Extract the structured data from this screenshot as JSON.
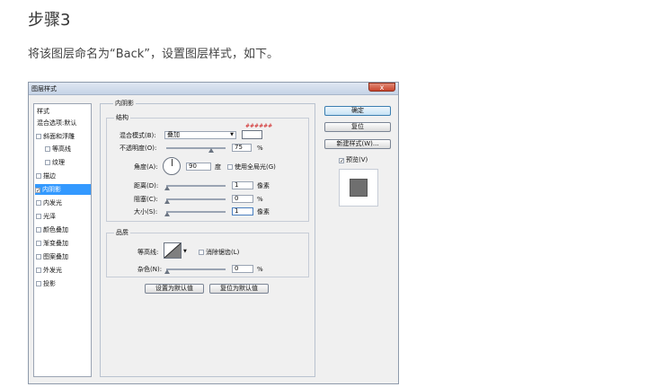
{
  "page": {
    "step_title": "步骤3",
    "instruction": "将该图层命名为“Back”，设置图层样式，如下。"
  },
  "dialog": {
    "title": "图层样式",
    "close_label": "x",
    "styles_list": {
      "header": "样式",
      "blend_options": "混合选项:默认",
      "items": [
        {
          "label": "斜面和浮雕",
          "checked": false
        },
        {
          "label": "等高线",
          "checked": false
        },
        {
          "label": "纹理",
          "checked": false
        },
        {
          "label": "描边",
          "checked": false
        },
        {
          "label": "内阴影",
          "checked": true
        },
        {
          "label": "内发光",
          "checked": false
        },
        {
          "label": "光泽",
          "checked": false
        },
        {
          "label": "颜色叠加",
          "checked": false
        },
        {
          "label": "渐变叠加",
          "checked": false
        },
        {
          "label": "图案叠加",
          "checked": false
        },
        {
          "label": "外发光",
          "checked": false
        },
        {
          "label": "投影",
          "checked": false
        }
      ]
    },
    "inner_shadow": {
      "title": "内阴影",
      "structure": {
        "title": "结构",
        "color_note": "######",
        "blend_mode_label": "混合模式(B):",
        "blend_mode_value": "叠加",
        "opacity_label": "不透明度(O):",
        "opacity_value": "75",
        "opacity_unit": "%",
        "opacity_fraction": 0.75,
        "angle_label": "角度(A):",
        "angle_value": "90",
        "angle_unit": "度",
        "global_light_label": "使用全局光(G)",
        "global_light_checked": false,
        "distance_label": "距离(D):",
        "distance_value": "1",
        "distance_unit": "像素",
        "choke_label": "阻塞(C):",
        "choke_value": "0",
        "choke_unit": "%",
        "size_label": "大小(S):",
        "size_value": "1",
        "size_unit": "像素"
      },
      "quality": {
        "title": "品质",
        "contour_label": "等高线:",
        "antialias_label": "消除锯齿(L)",
        "antialias_checked": false,
        "noise_label": "杂色(N):",
        "noise_value": "0",
        "noise_unit": "%"
      },
      "make_default": "设置为默认值",
      "reset_default": "复位为默认值"
    },
    "buttons": {
      "ok": "确定",
      "reset": "复位",
      "new_style": "新建样式(W)...",
      "preview_label": "预览(V)",
      "preview_checked": true
    }
  }
}
